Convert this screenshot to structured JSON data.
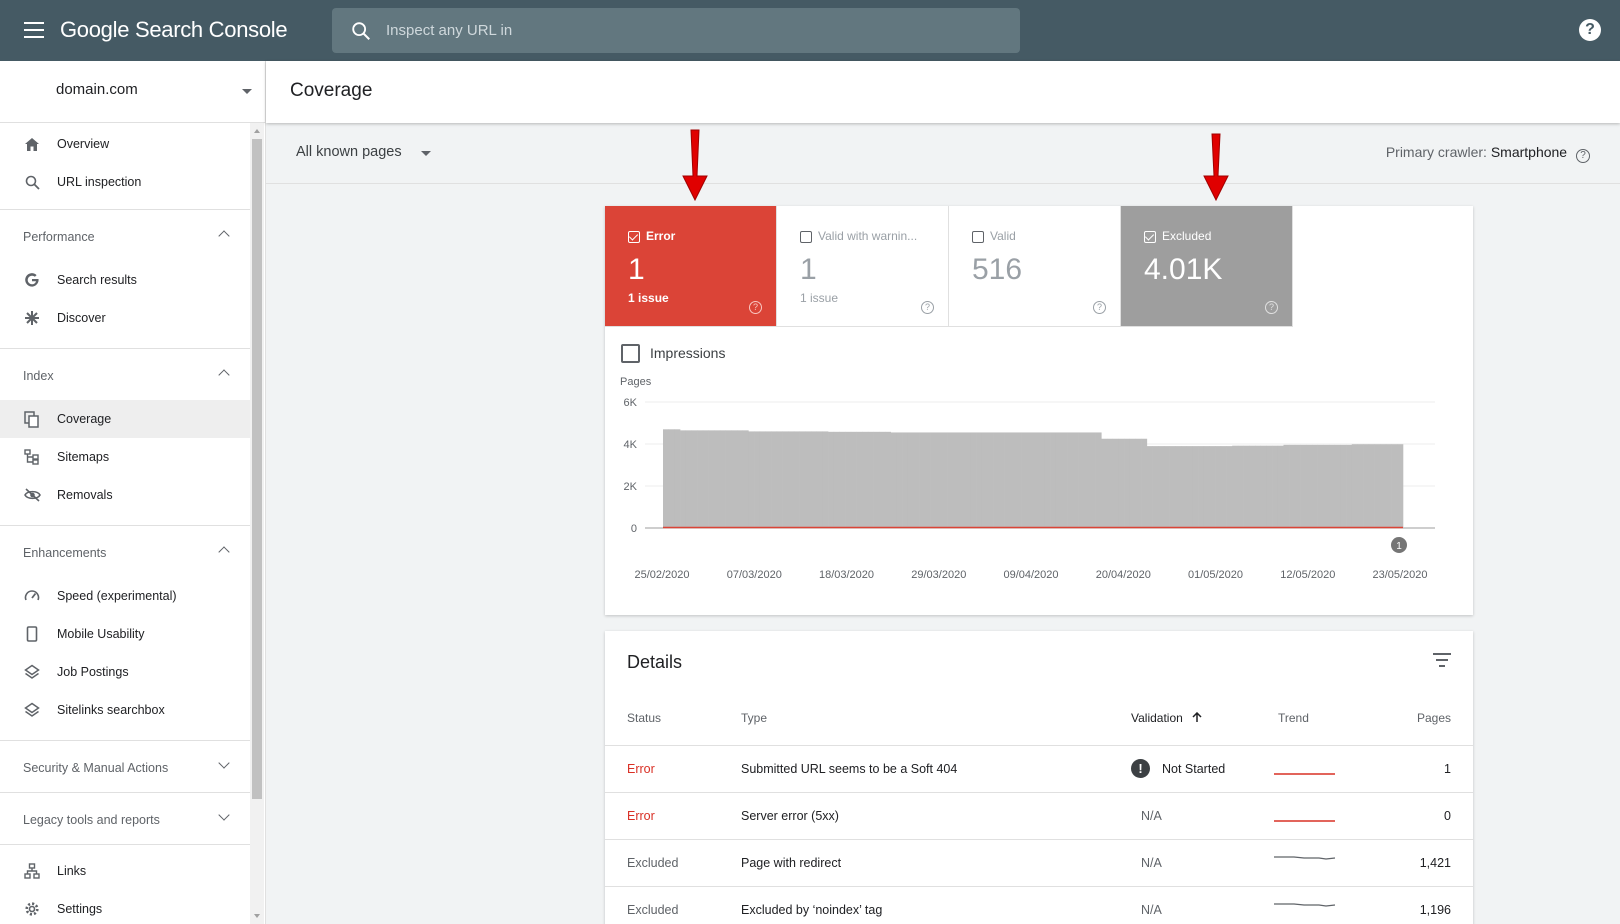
{
  "app": {
    "title": "Google Search Console",
    "search_placeholder": "Inspect any URL in"
  },
  "sidebar": {
    "property": "domain.com",
    "top_items": [
      {
        "label": "Overview",
        "icon": "home-icon"
      },
      {
        "label": "URL inspection",
        "icon": "search-icon"
      }
    ],
    "sections": [
      {
        "label": "Performance",
        "expanded": true,
        "items": [
          {
            "label": "Search results",
            "icon": "google-g-icon"
          },
          {
            "label": "Discover",
            "icon": "asterisk-icon"
          }
        ]
      },
      {
        "label": "Index",
        "expanded": true,
        "items": [
          {
            "label": "Coverage",
            "icon": "coverage-icon",
            "active": true
          },
          {
            "label": "Sitemaps",
            "icon": "sitemap-icon"
          },
          {
            "label": "Removals",
            "icon": "eye-off-icon"
          }
        ]
      },
      {
        "label": "Enhancements",
        "expanded": true,
        "items": [
          {
            "label": "Speed (experimental)",
            "icon": "speedometer-icon"
          },
          {
            "label": "Mobile Usability",
            "icon": "phone-icon"
          },
          {
            "label": "Job Postings",
            "icon": "layers-icon"
          },
          {
            "label": "Sitelinks searchbox",
            "icon": "layers-icon"
          }
        ]
      },
      {
        "label": "Security & Manual Actions",
        "expanded": false,
        "items": []
      },
      {
        "label": "Legacy tools and reports",
        "expanded": false,
        "items": []
      }
    ],
    "bottom_items": [
      {
        "label": "Links",
        "icon": "links-icon"
      },
      {
        "label": "Settings",
        "icon": "gear-icon"
      }
    ]
  },
  "page": {
    "title": "Coverage",
    "filter": "All known pages",
    "crawler_label": "Primary crawler:",
    "crawler_value": "Smartphone"
  },
  "tiles": [
    {
      "label": "Error",
      "value": "1",
      "sub": "1 issue",
      "checked": true,
      "style": "error"
    },
    {
      "label": "Valid with warnin...",
      "value": "1",
      "sub": "1 issue",
      "checked": false,
      "style": "plain"
    },
    {
      "label": "Valid",
      "value": "516",
      "sub": "",
      "checked": false,
      "style": "plain"
    },
    {
      "label": "Excluded",
      "value": "4.01K",
      "sub": "",
      "checked": true,
      "style": "excluded"
    }
  ],
  "impressions_label": "Impressions",
  "colors": {
    "error": "#db4437",
    "excluded": "#9e9e9e",
    "topbar": "#455a64",
    "arrow": "#e00000"
  },
  "chart_data": {
    "type": "bar",
    "ylabel": "Pages",
    "yticks": [
      "0",
      "2K",
      "4K",
      "6K"
    ],
    "ylim": [
      0,
      6000
    ],
    "xtick_labels": [
      "25/02/2020",
      "07/03/2020",
      "18/03/2020",
      "29/03/2020",
      "09/04/2020",
      "20/04/2020",
      "01/05/2020",
      "12/05/2020",
      "23/05/2020"
    ],
    "annotation": "1",
    "grid": true,
    "series": [
      {
        "name": "Excluded",
        "color": "#bdbdbd",
        "values": [
          4700,
          4700,
          4700,
          4650,
          4650,
          4650,
          4650,
          4650,
          4650,
          4650,
          4650,
          4650,
          4650,
          4650,
          4650,
          4600,
          4600,
          4600,
          4600,
          4600,
          4600,
          4600,
          4600,
          4600,
          4600,
          4600,
          4600,
          4600,
          4600,
          4580,
          4580,
          4580,
          4580,
          4580,
          4580,
          4580,
          4580,
          4580,
          4580,
          4580,
          4550,
          4550,
          4550,
          4550,
          4550,
          4550,
          4550,
          4550,
          4550,
          4550,
          4550,
          4550,
          4550,
          4550,
          4550,
          4550,
          4550,
          4550,
          4550,
          4550,
          4550,
          4550,
          4550,
          4550,
          4550,
          4550,
          4550,
          4550,
          4550,
          4550,
          4550,
          4550,
          4550,
          4550,
          4550,
          4550,
          4550,
          4250,
          4250,
          4250,
          4250,
          4250,
          4250,
          4250,
          4250,
          3900,
          3900,
          3900,
          3900,
          3900,
          3900,
          3900,
          3900,
          3900,
          3900,
          3900,
          3900,
          3900,
          3900,
          3900,
          3920,
          3920,
          3920,
          3920,
          3920,
          3920,
          3920,
          3920,
          3920,
          3960,
          3960,
          3960,
          3960,
          3960,
          3960,
          3960,
          3960,
          3960,
          3960,
          3960,
          3960,
          3990,
          3990,
          3990,
          3990,
          3990,
          3990,
          3990,
          3990,
          3990
        ]
      },
      {
        "name": "Error",
        "color": "#db4437",
        "values": []
      }
    ]
  },
  "details": {
    "title": "Details",
    "columns": [
      "Status",
      "Type",
      "Validation",
      "Trend",
      "Pages"
    ],
    "rows": [
      {
        "status": "Error",
        "type": "Submitted URL seems to be a Soft 404",
        "validation": "Not Started",
        "pages": "1",
        "warn": true
      },
      {
        "status": "Error",
        "type": "Server error (5xx)",
        "validation": "N/A",
        "pages": "0",
        "warn": false
      },
      {
        "status": "Excluded",
        "type": "Page with redirect",
        "validation": "N/A",
        "pages": "1,421",
        "warn": false
      },
      {
        "status": "Excluded",
        "type": "Excluded by ‘noindex’ tag",
        "validation": "N/A",
        "pages": "1,196",
        "warn": false
      }
    ]
  }
}
